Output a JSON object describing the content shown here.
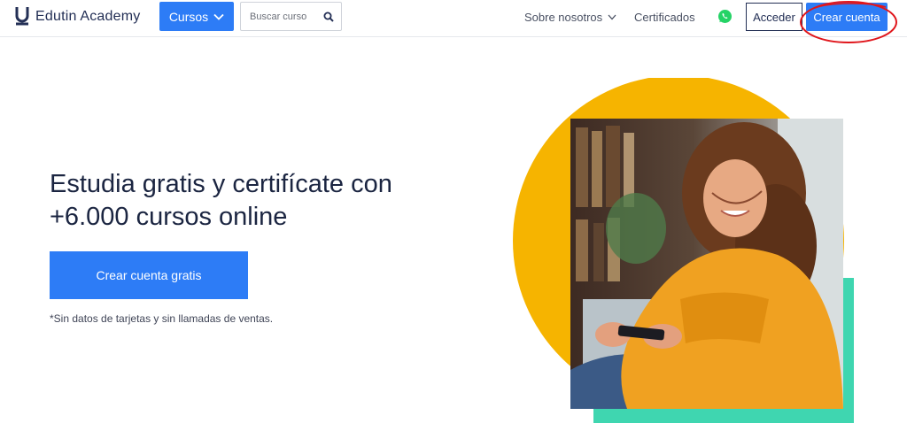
{
  "brand": {
    "name": "Edutin Academy"
  },
  "nav": {
    "courses_label": "Cursos",
    "search_placeholder": "Buscar curso",
    "about_label": "Sobre nosotros",
    "certificates_label": "Certificados",
    "login_label": "Acceder",
    "signup_label": "Crear cuenta"
  },
  "hero": {
    "title_line1": "Estudia gratis y certifícate con",
    "title_line2": "+6.000 cursos online",
    "cta_label": "Crear cuenta gratis",
    "note": "*Sin datos de tarjetas y sin llamadas de ventas."
  },
  "icons": {
    "logo": "edutin-u-logo-icon",
    "courses_chevron": "chevron-down-icon",
    "search": "search-icon",
    "about_chevron": "chevron-down-icon",
    "whatsapp": "whatsapp-icon"
  },
  "colors": {
    "primary": "#2d7cf6",
    "navy": "#232f55",
    "yellow": "#f6b400",
    "teal": "#3fd6b0",
    "annotation": "#e0161c",
    "whatsapp": "#25d366"
  }
}
